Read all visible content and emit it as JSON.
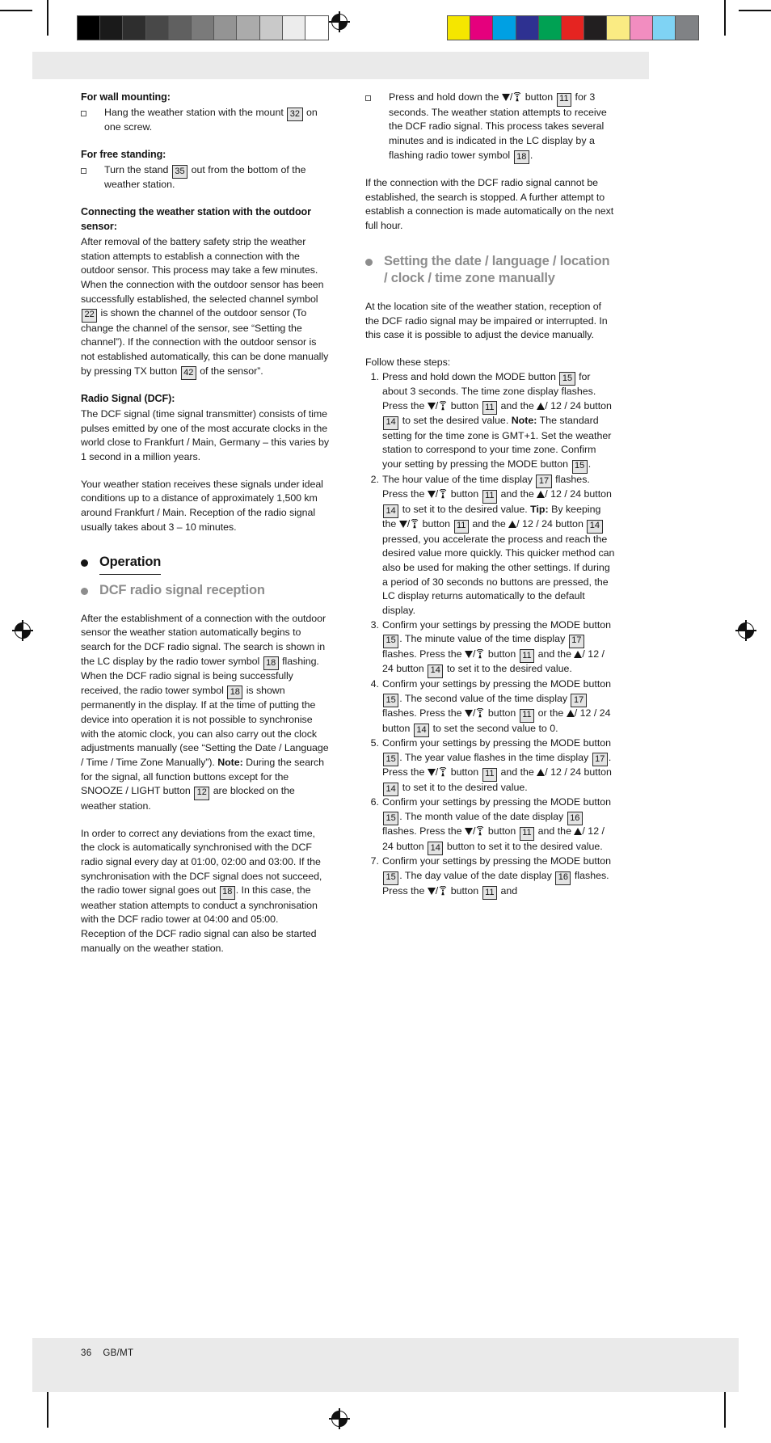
{
  "production": {
    "grayscale_swatches": [
      "#000000",
      "#1a1a1a",
      "#2e2e2e",
      "#484848",
      "#606060",
      "#7a7a7a",
      "#949494",
      "#ababab",
      "#c9c9c9",
      "#ececec",
      "#ffffff"
    ],
    "color_swatches": [
      "#f5e600",
      "#e5007d",
      "#00a0e3",
      "#2e3191",
      "#00a153",
      "#e52421",
      "#221f20",
      "#faeb83",
      "#f28dc0",
      "#7fd3f4",
      "#808285"
    ]
  },
  "footer": {
    "page_number": "36",
    "language_code": "GB/MT"
  },
  "left_column": {
    "wall_mounting_heading": "For wall mounting:",
    "wall_mounting_item_a": "Hang the weather station with the mount",
    "wall_mounting_ref": "32",
    "wall_mounting_item_b": "on one screw.",
    "free_standing_heading": "For free standing:",
    "free_standing_a": "Turn the stand",
    "free_standing_ref": "35",
    "free_standing_b": "out from the bottom of the weather station.",
    "connecting_heading": "Connecting the weather station with the outdoor sensor:",
    "connecting_p1_a": "After removal of the battery safety strip the weather station attempts to establish a connection with the outdoor sensor. This process may take a few minutes. When the connection with the outdoor sensor has been successfully established, the selected channel symbol",
    "connecting_ref1": "22",
    "connecting_p1_b": "is shown the channel of the outdoor sensor (To change the channel of the sensor, see “Setting the channel”). If the connection with the outdoor sensor is not established automatically, this can be done manually by pressing TX button",
    "connecting_ref2": "42",
    "connecting_p1_c": "of the sensor”.",
    "radio_signal_heading": "Radio Signal (DCF):",
    "radio_signal_p1": "The DCF signal (time signal transmitter) consists of time pulses emitted by one of the most accurate clocks in the world close to Frankfurt / Main, Germany – this varies by 1 second in a million years.",
    "radio_signal_p2": "Your weather station receives these signals under ideal conditions up to a distance of approximately 1,500 km around Frankfurt / Main. Reception of the radio signal usually takes about 3 – 10 minutes.",
    "operation_heading": "Operation",
    "dcf_reception_heading": "DCF radio signal reception",
    "dcf_p1_a": "After the establishment of a connection with the outdoor sensor the weather station automatically begins to search for the DCF radio signal. The search is shown in the LC display by the radio tower symbol",
    "dcf_ref1": "18",
    "dcf_p1_b": "flashing.",
    "dcf_p2_a": "When the DCF radio signal is being successfully received, the radio tower symbol",
    "dcf_ref2": "18",
    "dcf_p2_b": "is shown permanently in the display. If at the time of putting the device into operation it is not possible to synchronise with the atomic clock, you can also carry out the clock adjustments manually (see “Setting the Date / Language / Time / Time Zone Manually”).",
    "dcf_note_label": "Note:",
    "dcf_note_a": "During the search for the signal, all function buttons except for the SNOOZE / LIGHT button",
    "dcf_note_ref": "12",
    "dcf_note_b": "are blocked on the weather station.",
    "dcf_p3_a": "In order to correct any deviations from the exact time, the clock is automatically synchronised with the DCF radio signal every day at 01:00, 02:00 and 03:00. If the synchronisation with the DCF signal does not succeed, the radio tower signal goes out",
    "dcf_p3_ref": "18",
    "dcf_p3_b": ". In this case, the weather station attempts to conduct a synchronisation with the DCF radio tower at 04:00 and 05:00.",
    "dcf_p4": "Reception of the DCF radio signal can also be started manually on the weather station."
  },
  "right_column": {
    "press_hold_a": "Press and hold down the",
    "press_hold_btn_ref": "11",
    "press_hold_b": "for 3 seconds. The weather station attempts to receive the DCF radio signal. This process takes several minutes and is indicated in the LC display by a flashing radio tower symbol",
    "press_hold_ref2": "18",
    "press_hold_c": ".",
    "button_word": "button",
    "connection_fail_p": "If the connection with the DCF radio signal cannot be established, the search is stopped. A further attempt to establish a connection is made automatically on the next full hour.",
    "setting_heading": "Setting the date / language / location / clock / time zone manually",
    "setting_intro": "At the location site of the weather station, reception of the DCF radio signal may be impaired or interrupted. In this case it is possible to adjust the device manually.",
    "follow_steps": "Follow these steps:",
    "steps": [
      {
        "num": "1.",
        "a": "Press and hold down the MODE button",
        "ref_mode": "15",
        "b": "for about 3 seconds. The time zone display flashes. Press the",
        "ref_down": "11",
        "c": "and the",
        "ref_up": "14",
        "d": "to set the desired value.",
        "note_label": "Note:",
        "note": "The standard setting for the time zone is GMT+1. Set the weather station to correspond to your time zone. Confirm your setting by pressing the MODE button",
        "note_ref": "15",
        "note_end": "."
      },
      {
        "num": "2.",
        "a": "The hour value of the time display",
        "ref_display": "17",
        "b": "flashes. Press the",
        "ref_down": "11",
        "c": "and the",
        "ref_up": "14",
        "d": "to set it to the desired value.",
        "tip_label": "Tip:",
        "tip_a": "By keeping the",
        "tip_ref_down": "11",
        "tip_b": "and the",
        "tip_ref_up": "14",
        "tip_c": "pressed, you accelerate the process and reach the desired value more quickly. This quicker method can also be used for making the other settings. If during a period of 30 seconds no buttons are pressed, the LC display returns automatically to the default display."
      },
      {
        "num": "3.",
        "a": "Confirm your settings by pressing the MODE button",
        "ref_mode": "15",
        "b": ". The minute value of the time display",
        "ref_display": "17",
        "c": "flashes. Press the",
        "ref_down": "11",
        "d": "and the",
        "ref_up": "14",
        "e": "to set it to the desired value."
      },
      {
        "num": "4.",
        "a": "Confirm your settings by pressing the MODE button",
        "ref_mode": "15",
        "b": ". The second value of the time display",
        "ref_display": "17",
        "c": "flashes. Press the",
        "ref_down": "11",
        "d": "or the",
        "ref_up": "14",
        "e": "to set the second value to 0."
      },
      {
        "num": "5.",
        "a": "Confirm your settings by pressing the MODE button",
        "ref_mode": "15",
        "b": ". The year value flashes in the time display",
        "ref_display": "17",
        "c": ". Press the",
        "ref_down": "11",
        "d": "and the",
        "ref_up": "14",
        "e": "to set it to the desired value."
      },
      {
        "num": "6.",
        "a": "Confirm your settings by pressing the MODE button",
        "ref_mode": "15",
        "b": ". The month value of the date display",
        "ref_display": "16",
        "c": "flashes. Press the",
        "ref_down": "11",
        "d": "and the",
        "ref_up": "14",
        "e": "button to set it to the desired value."
      },
      {
        "num": "7.",
        "a": "Confirm your settings by pressing the MODE button",
        "ref_mode": "15",
        "b": ". The day value of the date display",
        "ref_display": "16",
        "c": "flashes. Press the",
        "ref_down": "11",
        "d": "and"
      }
    ],
    "label_12_24": "/ 12 / 24 button",
    "label_button": "button"
  }
}
